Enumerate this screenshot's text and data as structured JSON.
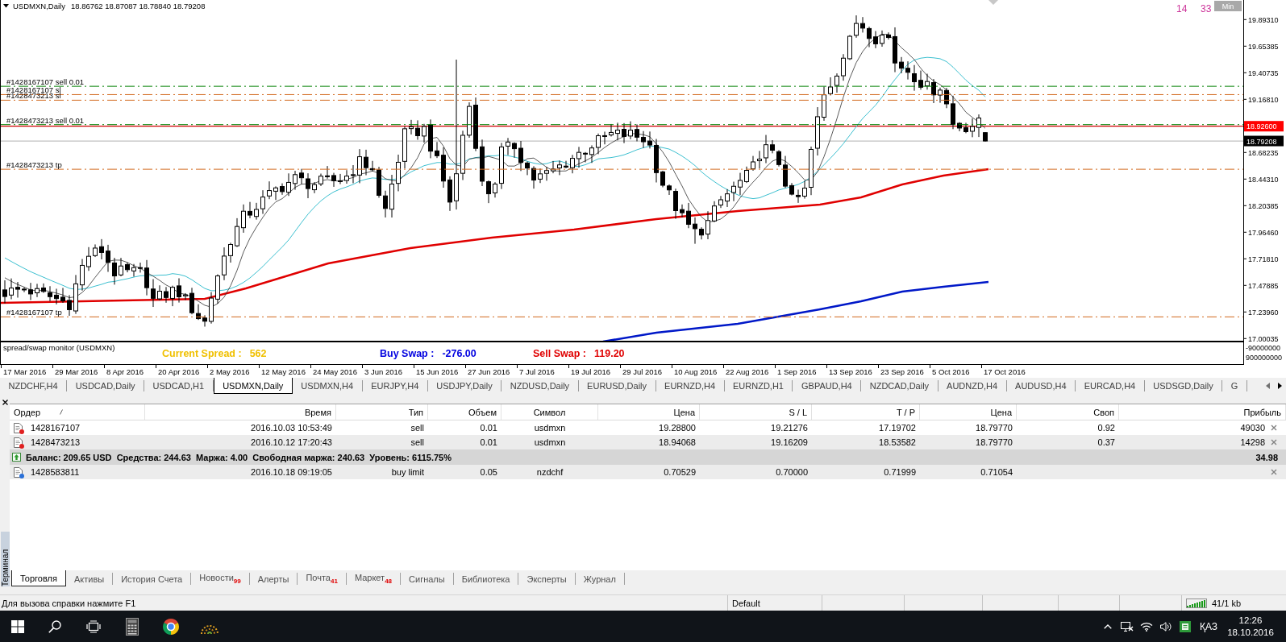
{
  "chart": {
    "title": "USDMXN,Daily",
    "ohlc": "18.86762 18.87087 18.78840 18.79208",
    "counters": [
      "14",
      "33"
    ],
    "min_button": "Min",
    "price_ticks": [
      "19.89310",
      "19.65385",
      "19.40735",
      "19.16810",
      "18.68235",
      "18.44310",
      "18.20385",
      "17.96460",
      "17.71810",
      "17.47885",
      "17.23960",
      "17.00035"
    ],
    "price_tags": [
      {
        "text": "18.92600",
        "kind": "level"
      },
      {
        "text": "18.79208",
        "kind": "bid"
      }
    ],
    "order_lines": [
      {
        "label": "#1428167107 sell 0.01",
        "kind": "order"
      },
      {
        "label": "#1428167107 sl",
        "kind": "stop"
      },
      {
        "label": "#1428473213 sl",
        "kind": "stop"
      },
      {
        "label": "#1428473213 sell 0.01",
        "kind": "order"
      },
      {
        "label": "#1428473213 tp",
        "kind": "target"
      },
      {
        "label": "#1428167107 tp",
        "kind": "target"
      }
    ],
    "indicator": {
      "title": "spread/swap monitor (USDMXN)",
      "readouts": [
        {
          "label": "Current Spread :",
          "value": "562",
          "color": "#f0c000"
        },
        {
          "label": "Buy Swap :",
          "value": "-276.00",
          "color": "#0000e0"
        },
        {
          "label": "Sell Swap :",
          "value": "119.20",
          "color": "#e00000"
        }
      ],
      "scale": [
        "-90000000",
        "900000000"
      ]
    },
    "dates": [
      "17 Mar 2016",
      "29 Mar 2016",
      "8 Apr 2016",
      "20 Apr 2016",
      "2 May 2016",
      "12 May 2016",
      "24 May 2016",
      "3 Jun 2016",
      "15 Jun 2016",
      "27 Jun 2016",
      "7 Jul 2016",
      "19 Jul 2016",
      "29 Jul 2016",
      "10 Aug 2016",
      "22 Aug 2016",
      "1 Sep 2016",
      "13 Sep 2016",
      "23 Sep 2016",
      "5 Oct 2016",
      "17 Oct 2016"
    ]
  },
  "chart_tabs": [
    {
      "label": "NZDCHF,H4",
      "selected": false
    },
    {
      "label": "USDCAD,Daily",
      "selected": false
    },
    {
      "label": "USDCAD,H1",
      "selected": false
    },
    {
      "label": "USDMXN,Daily",
      "selected": true
    },
    {
      "label": "USDMXN,H4",
      "selected": false
    },
    {
      "label": "EURJPY,H4",
      "selected": false
    },
    {
      "label": "USDJPY,Daily",
      "selected": false
    },
    {
      "label": "NZDUSD,Daily",
      "selected": false
    },
    {
      "label": "EURUSD,Daily",
      "selected": false
    },
    {
      "label": "EURNZD,H4",
      "selected": false
    },
    {
      "label": "EURNZD,H1",
      "selected": false
    },
    {
      "label": "GBPAUD,H4",
      "selected": false
    },
    {
      "label": "NZDCAD,Daily",
      "selected": false
    },
    {
      "label": "AUDNZD,H4",
      "selected": false
    },
    {
      "label": "AUDUSD,H4",
      "selected": false
    },
    {
      "label": "EURCAD,H4",
      "selected": false
    },
    {
      "label": "USDSGD,Daily",
      "selected": false
    },
    {
      "label": "G",
      "selected": false
    }
  ],
  "terminal": {
    "side_label": "Терминал",
    "columns": [
      "Ордер",
      "Время",
      "Тип",
      "Объем",
      "Символ",
      "Цена",
      "S / L",
      "T / P",
      "Цена",
      "Своп",
      "Прибыль"
    ],
    "rows": [
      {
        "kind": "order",
        "color": "#e02020",
        "order": "1428167107",
        "time": "2016.10.03 10:53:49",
        "type": "sell",
        "volume": "0.01",
        "symbol": "usdmxn",
        "price": "19.28800",
        "sl": "19.21276",
        "tp": "17.19702",
        "current": "18.79770",
        "swap": "0.92",
        "profit": "49030"
      },
      {
        "kind": "order",
        "color": "#e02020",
        "order": "1428473213",
        "time": "2016.10.12 17:20:43",
        "type": "sell",
        "volume": "0.01",
        "symbol": "usdmxn",
        "price": "18.94068",
        "sl": "19.16209",
        "tp": "18.53582",
        "current": "18.79770",
        "swap": "0.37",
        "profit": "14298"
      },
      {
        "kind": "balance",
        "text": "Баланс: 209.65 USD  Средства: 244.63  Маржа: 4.00  Свободная маржа: 240.63  Уровень: 6115.75%",
        "profit": "34.98"
      },
      {
        "kind": "order",
        "color": "#2a70d8",
        "order": "1428583811",
        "time": "2016.10.18 09:19:05",
        "type": "buy limit",
        "volume": "0.05",
        "symbol": "nzdchf",
        "price": "0.70529",
        "sl": "0.70000",
        "tp": "0.71999",
        "current": "0.71054"
      }
    ],
    "tabs": [
      {
        "label": "Торговля",
        "selected": true
      },
      {
        "label": "Активы",
        "selected": false
      },
      {
        "label": "История Счета",
        "selected": false
      },
      {
        "label": "Новости",
        "count": "99",
        "selected": false
      },
      {
        "label": "Алерты",
        "selected": false
      },
      {
        "label": "Почта",
        "count": "41",
        "selected": false
      },
      {
        "label": "Маркет",
        "count": "48",
        "selected": false
      },
      {
        "label": "Сигналы",
        "selected": false
      },
      {
        "label": "Библиотека",
        "selected": false
      },
      {
        "label": "Эксперты",
        "selected": false
      },
      {
        "label": "Журнал",
        "selected": false
      }
    ]
  },
  "status_bar": {
    "help": "Для вызова справки нажмите F1",
    "profile": "Default",
    "traffic": "41/1 kb"
  },
  "taskbar": {
    "language": "ҚАЗ",
    "time": "12:26",
    "date": "18.10.2016"
  }
}
